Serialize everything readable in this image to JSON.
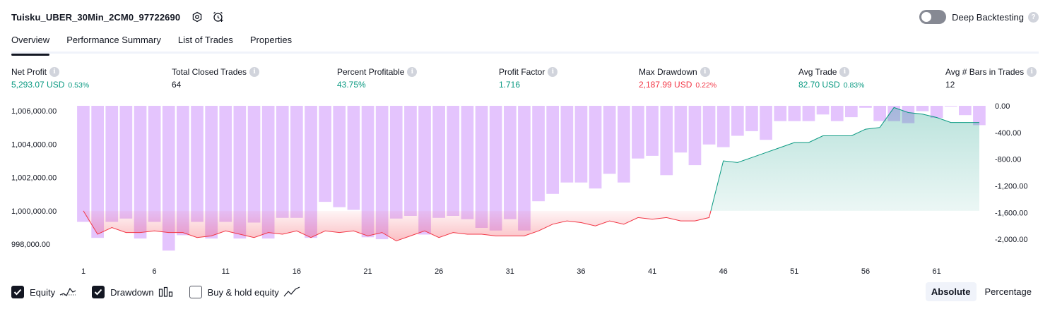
{
  "header": {
    "title": "Tuisku_UBER_30Min_2CM0_97722690",
    "deep_backtesting_label": "Deep Backtesting",
    "help_glyph": "?"
  },
  "tabs": [
    {
      "label": "Overview",
      "active": true
    },
    {
      "label": "Performance Summary",
      "active": false
    },
    {
      "label": "List of Trades",
      "active": false
    },
    {
      "label": "Properties",
      "active": false
    }
  ],
  "metrics": {
    "info_glyph": "i",
    "net_profit": {
      "label": "Net Profit",
      "value": "5,293.07 USD",
      "pct": "0.53%"
    },
    "total_closed_trades": {
      "label": "Total Closed Trades",
      "value": "64"
    },
    "percent_profitable": {
      "label": "Percent Profitable",
      "value": "43.75%"
    },
    "profit_factor": {
      "label": "Profit Factor",
      "value": "1.716"
    },
    "max_drawdown": {
      "label": "Max Drawdown",
      "value": "2,187.99 USD",
      "pct": "0.22%"
    },
    "avg_trade": {
      "label": "Avg Trade",
      "value": "82.70 USD",
      "pct": "0.83%"
    },
    "avg_bars": {
      "label": "Avg # Bars in Trades",
      "value": "12"
    }
  },
  "colors": {
    "profit_green": "#089981",
    "loss_red": "#f23645",
    "drawdown_purple": "#ce93fb",
    "text": "#131722"
  },
  "chart_data": {
    "type": "area",
    "x": [
      1,
      2,
      3,
      4,
      5,
      6,
      7,
      8,
      9,
      10,
      11,
      12,
      13,
      14,
      15,
      16,
      17,
      18,
      19,
      20,
      21,
      22,
      23,
      24,
      25,
      26,
      27,
      28,
      29,
      30,
      31,
      32,
      33,
      34,
      35,
      36,
      37,
      38,
      39,
      40,
      41,
      42,
      43,
      44,
      45,
      46,
      47,
      48,
      49,
      50,
      51,
      52,
      53,
      54,
      55,
      56,
      57,
      58,
      59,
      60,
      61,
      62,
      63,
      64
    ],
    "x_ticks": [
      "1",
      "6",
      "11",
      "16",
      "21",
      "26",
      "31",
      "36",
      "41",
      "46",
      "51",
      "56",
      "61"
    ],
    "x_tick_values": [
      1,
      6,
      11,
      16,
      21,
      26,
      31,
      36,
      41,
      46,
      51,
      56,
      61
    ],
    "left_axis": {
      "ticks": [
        "1,006,000.00",
        "1,004,000.00",
        "1,002,000.00",
        "1,000,000.00",
        "998,000.00"
      ],
      "tick_values": [
        1006000,
        1004000,
        1002000,
        1000000,
        998000
      ],
      "range": [
        997500,
        1006300
      ]
    },
    "right_axis": {
      "ticks": [
        "0.00",
        "-400.00",
        "-800.00",
        "-1,200.00",
        "-1,600.00",
        "-2,000.00"
      ],
      "tick_values": [
        0,
        -400,
        -800,
        -1200,
        -1600,
        -2000
      ],
      "range": [
        -2200,
        0
      ]
    },
    "baseline": 1000000,
    "series": [
      {
        "name": "Equity",
        "axis": "left",
        "values": [
          1000000,
          998600,
          999000,
          998700,
          998700,
          998800,
          998700,
          998700,
          998400,
          998500,
          998800,
          998600,
          998400,
          998700,
          998600,
          998800,
          998400,
          998800,
          998700,
          998800,
          998500,
          998700,
          998200,
          998500,
          998800,
          998400,
          998700,
          998600,
          998600,
          998500,
          998500,
          998500,
          998800,
          999200,
          999400,
          999300,
          999100,
          999400,
          999200,
          999600,
          999500,
          999600,
          999400,
          999400,
          999600,
          1003000,
          1002900,
          1003200,
          1003500,
          1003800,
          1004100,
          1004100,
          1004500,
          1004500,
          1004500,
          1004900,
          1005000,
          1006200,
          1005900,
          1005800,
          1005600,
          1005300,
          1005300,
          1005300,
          1005200,
          1005200,
          1005200,
          1005300
        ]
      },
      {
        "name": "Drawdown",
        "axis": "right",
        "values": [
          -1740,
          -1980,
          -1740,
          -1690,
          -1990,
          -1740,
          -2170,
          -1940,
          -1740,
          -1990,
          -1740,
          -1990,
          -1750,
          -1990,
          -1680,
          -1680,
          -1980,
          -1440,
          -1520,
          -1560,
          -1970,
          -2000,
          -1690,
          -1650,
          -1930,
          -1680,
          -1650,
          -1700,
          -1830,
          -1870,
          -1700,
          -1870,
          -1430,
          -1320,
          -1150,
          -1150,
          -1240,
          -1020,
          -1150,
          -790,
          -750,
          -1040,
          -700,
          -890,
          -580,
          -620,
          -450,
          -380,
          -510,
          -230,
          -230,
          -230,
          -130,
          -230,
          -170,
          -30,
          -230,
          -230,
          -260,
          -80,
          -180,
          -10,
          -140,
          -290,
          -140,
          -570,
          -80,
          -40
        ]
      }
    ]
  },
  "legend": {
    "equity_label": "Equity",
    "drawdown_label": "Drawdown",
    "buy_hold_label": "Buy & hold equity"
  },
  "view_mode": {
    "absolute_label": "Absolute",
    "percentage_label": "Percentage"
  }
}
